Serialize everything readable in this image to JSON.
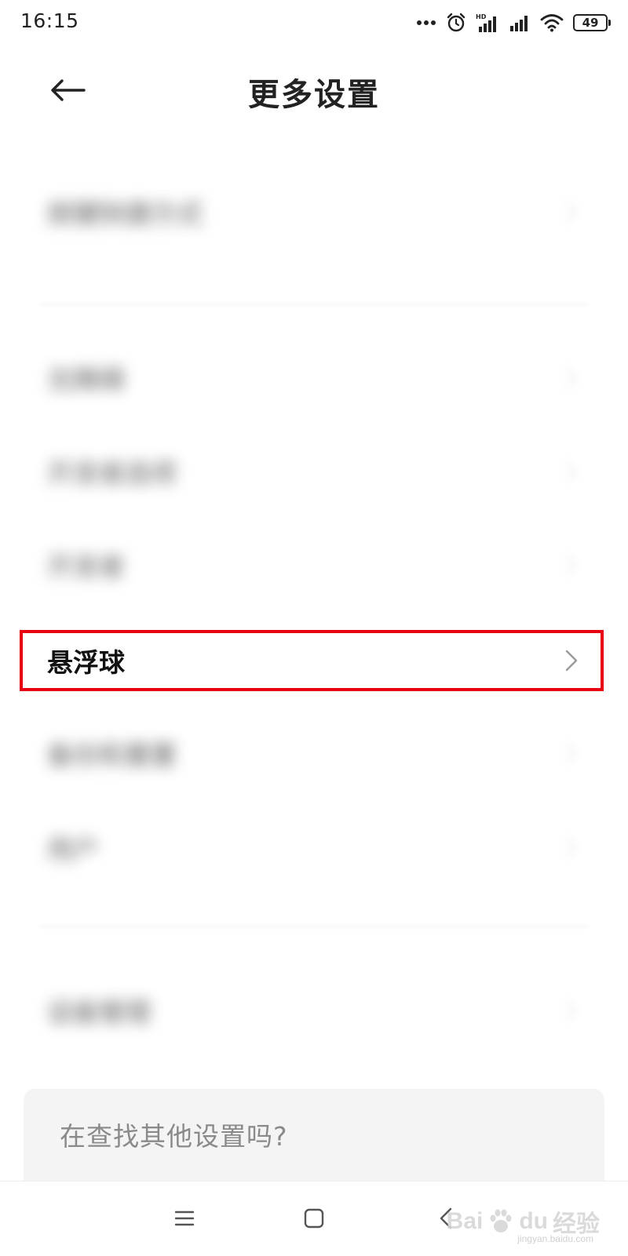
{
  "status_bar": {
    "time": "16:15",
    "battery": "49",
    "icons": [
      "more-dots-icon",
      "alarm-icon",
      "hd-signal-icon",
      "signal-icon",
      "wifi-icon",
      "battery-icon"
    ]
  },
  "header": {
    "title": "更多设置",
    "back_icon": "back-arrow-icon"
  },
  "list": {
    "items": [
      {
        "label": "按键快捷方式",
        "blurred": true
      },
      {
        "label": "无障碍",
        "blurred": true
      },
      {
        "label": "开发者选项",
        "blurred": true
      },
      {
        "label": "开发者",
        "blurred": true
      },
      {
        "label": "悬浮球",
        "blurred": false,
        "highlighted": true
      },
      {
        "label": "备份和重置",
        "blurred": true
      },
      {
        "label": "用户",
        "blurred": true
      },
      {
        "label": "设备管理",
        "blurred": true
      }
    ]
  },
  "search_card": {
    "text": "在查找其他设置吗?"
  },
  "nav": {
    "icons": [
      "menu-icon",
      "home-icon",
      "back-icon"
    ]
  },
  "watermark": {
    "brand": "Bai",
    "brand2": "du",
    "cn": "经验",
    "url": "jingyan.baidu.com"
  },
  "colors": {
    "highlight": "#e60012",
    "search_bg": "#f4f4f4",
    "search_text": "#8a8a8a"
  }
}
